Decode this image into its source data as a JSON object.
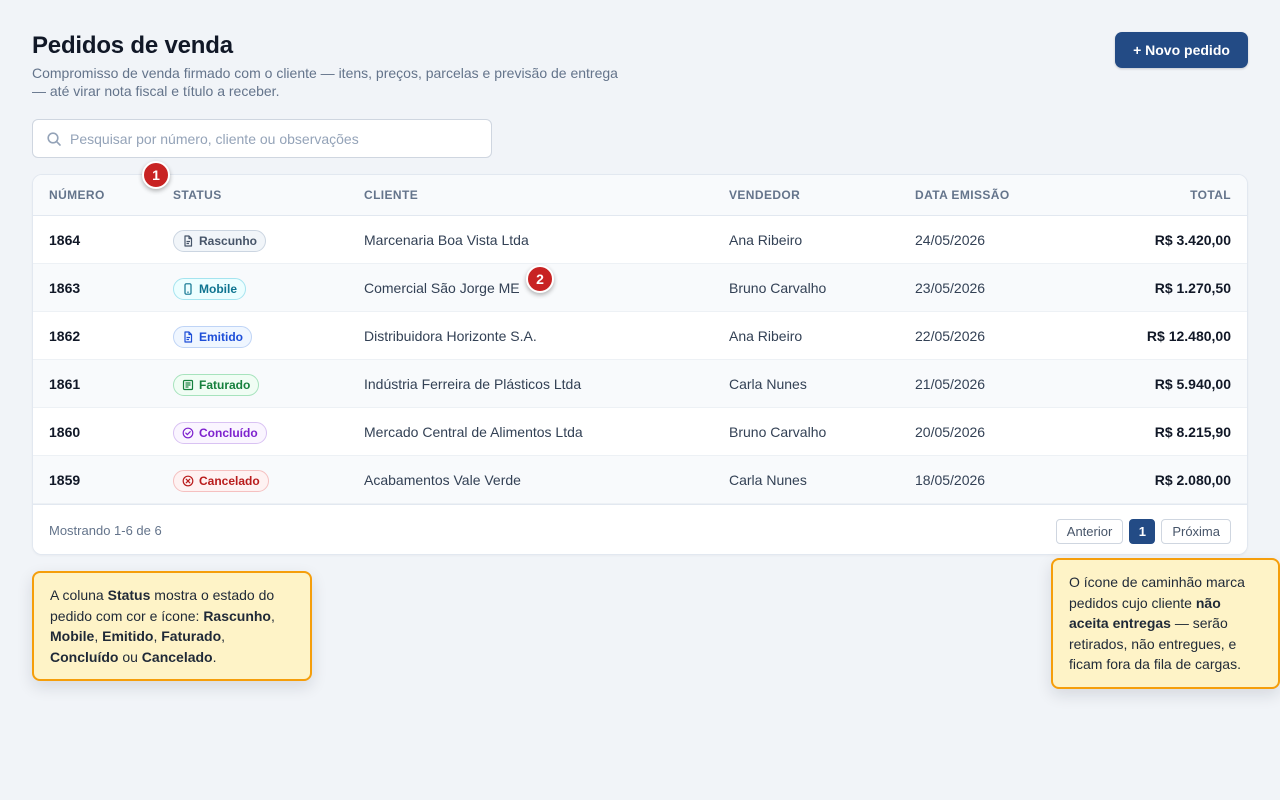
{
  "header": {
    "title": "Pedidos de venda",
    "subtitle": "Compromisso de venda firmado com o cliente — itens, preços, parcelas e previsão de entrega — até virar nota fiscal e título a receber.",
    "new_button_label": "+ Novo pedido"
  },
  "search": {
    "placeholder": "Pesquisar por número, cliente ou observações",
    "value": ""
  },
  "table": {
    "columns": [
      "NÚMERO",
      "STATUS",
      "CLIENTE",
      "VENDEDOR",
      "DATA EMISSÃO",
      "TOTAL"
    ],
    "rows": [
      {
        "numero": "1864",
        "status": "Rascunho",
        "cliente": "Marcenaria Boa Vista Ltda",
        "vendedor": "Ana Ribeiro",
        "data": "24/05/2026",
        "total": "R$ 3.420,00"
      },
      {
        "numero": "1863",
        "status": "Mobile",
        "cliente": "Comercial São Jorge ME",
        "vendedor": "Bruno Carvalho",
        "data": "23/05/2026",
        "total": "R$ 1.270,50"
      },
      {
        "numero": "1862",
        "status": "Emitido",
        "cliente": "Distribuidora Horizonte S.A.",
        "vendedor": "Ana Ribeiro",
        "data": "22/05/2026",
        "total": "R$ 12.480,00"
      },
      {
        "numero": "1861",
        "status": "Faturado",
        "cliente": "Indústria Ferreira de Plásticos Ltda",
        "vendedor": "Carla Nunes",
        "data": "21/05/2026",
        "total": "R$ 5.940,00"
      },
      {
        "numero": "1860",
        "status": "Concluído",
        "cliente": "Mercado Central de Alimentos Ltda",
        "vendedor": "Bruno Carvalho",
        "data": "20/05/2026",
        "total": "R$ 8.215,90"
      },
      {
        "numero": "1859",
        "status": "Cancelado",
        "cliente": "Acabamentos Vale Verde",
        "vendedor": "Carla Nunes",
        "data": "18/05/2026",
        "total": "R$ 2.080,00"
      }
    ],
    "footer_text": "Mostrando 1-6 de 6"
  },
  "pagination": {
    "prev_label": "Anterior",
    "current_page": "1",
    "next_label": "Próxima"
  },
  "status_styles": {
    "Rascunho": {
      "icon": "document-icon",
      "color": "#475569",
      "bg": "#f1f5f9",
      "border": "#cbd5e1"
    },
    "Mobile": {
      "icon": "smartphone-icon",
      "color": "#0e7490",
      "bg": "#ecfeff",
      "border": "#a5e4ef"
    },
    "Emitido": {
      "icon": "document-icon",
      "color": "#1d4ed8",
      "bg": "#eff6ff",
      "border": "#bfd4f6"
    },
    "Faturado": {
      "icon": "receipt-icon",
      "color": "#15803d",
      "bg": "#f0fdf4",
      "border": "#a7e3bd"
    },
    "Concluído": {
      "icon": "check-circle-icon",
      "color": "#7e22ce",
      "bg": "#faf5ff",
      "border": "#d9c2f3"
    },
    "Cancelado": {
      "icon": "x-circle-icon",
      "color": "#b91c1c",
      "bg": "#fef2f2",
      "border": "#f5c0c0"
    }
  },
  "markers": [
    "1",
    "2"
  ],
  "callouts": {
    "status": {
      "parts": [
        {
          "text": "A coluna ",
          "bold": false
        },
        {
          "text": "Status",
          "bold": true
        },
        {
          "text": " mostra o estado do pedido com cor e ícone: ",
          "bold": false
        },
        {
          "text": "Rascunho",
          "bold": true
        },
        {
          "text": ", ",
          "bold": false
        },
        {
          "text": "Mobile",
          "bold": true
        },
        {
          "text": ", ",
          "bold": false
        },
        {
          "text": "Emitido",
          "bold": true
        },
        {
          "text": ", ",
          "bold": false
        },
        {
          "text": "Faturado",
          "bold": true
        },
        {
          "text": ", ",
          "bold": false
        },
        {
          "text": "Concluído",
          "bold": true
        },
        {
          "text": " ou ",
          "bold": false
        },
        {
          "text": "Cancelado",
          "bold": true
        },
        {
          "text": ".",
          "bold": false
        }
      ]
    },
    "truck": {
      "parts": [
        {
          "text": "O ícone de caminhão marca pedidos cujo cliente ",
          "bold": false
        },
        {
          "text": "não aceita entregas",
          "bold": true
        },
        {
          "text": " — serão retirados, não entregues, e ficam fora da fila de cargas.",
          "bold": false
        }
      ]
    }
  },
  "colors": {
    "accent": "#234b85",
    "marker": "#c82323",
    "callout_bg": "#fef3c7",
    "callout_border": "#f59e0b"
  }
}
